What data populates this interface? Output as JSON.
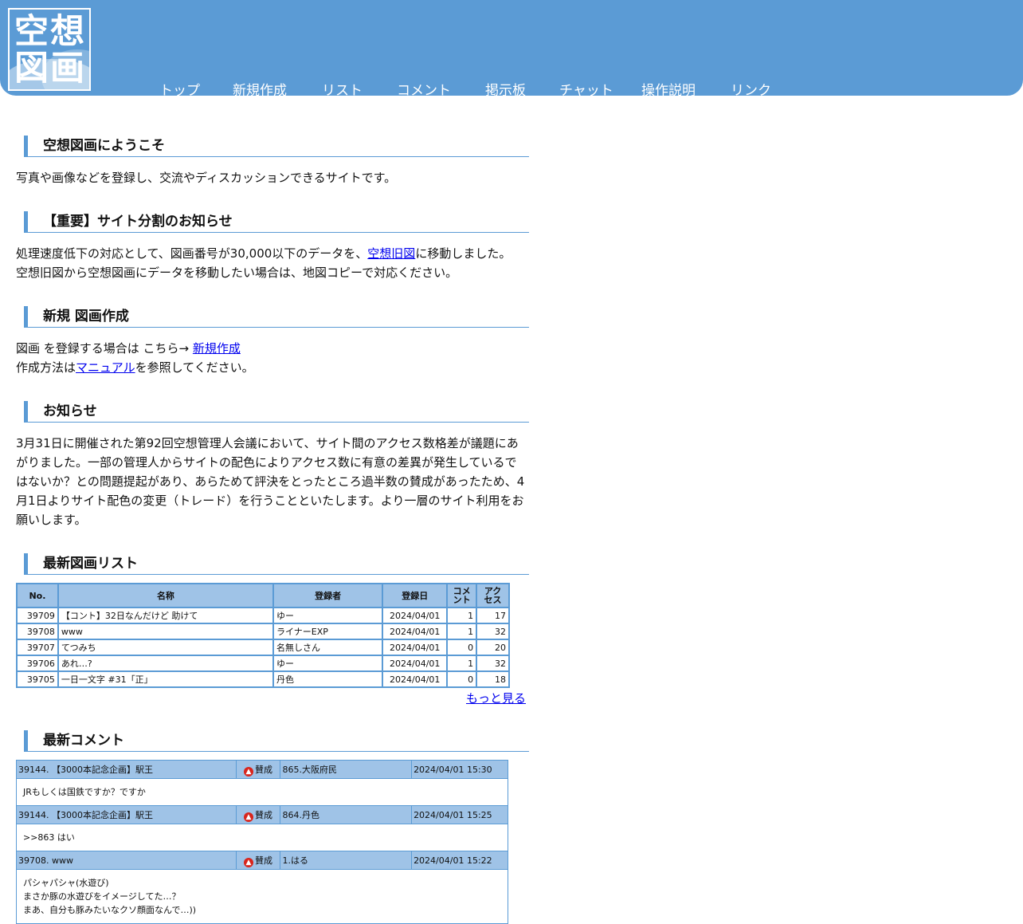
{
  "header": {
    "logo_line1": "空想",
    "logo_line2": "図画",
    "nav": [
      {
        "label": "トップ"
      },
      {
        "label": "新規作成"
      },
      {
        "label": "リスト"
      },
      {
        "label": "コメント"
      },
      {
        "label": "掲示板"
      },
      {
        "label": "チャット"
      },
      {
        "label": "操作説明"
      },
      {
        "label": "リンク"
      }
    ],
    "colors": {
      "bar": "#5b9bd5",
      "table_header": "#9fc3e7"
    }
  },
  "welcome": {
    "title": "空想図画にようこそ",
    "text": "写真や画像などを登録し、交流やディスカッションできるサイトです。"
  },
  "important": {
    "title": "【重要】サイト分割のお知らせ",
    "text_before": "処理速度低下の対応として、図画番号が30,000以下のデータを、",
    "link": "空想旧図",
    "text_after": "に移動しました。 空想旧図から空想図画にデータを移動したい場合は、地図コピーで対応ください。"
  },
  "create": {
    "title": "新規 図画作成",
    "line1_text": "図画 を登録する場合は こちら→ ",
    "line1_link": "新規作成",
    "line2_link": "マニュアル",
    "line2_text_before": "作成方法は",
    "line2_text_after": "を参照してください。"
  },
  "notice": {
    "title": "お知らせ",
    "text": "3月31日に開催された第92回空想管理人会議において、サイト間のアクセス数格差が議題にあがりました。一部の管理人からサイトの配色によりアクセス数に有意の差異が発生しているではないか？との問題提起があり、あらためて評決をとったところ過半数の賛成があったため、4月1日よりサイト配色の変更（トレード）を行うことといたします。より一層のサイト利用をお願いします。"
  },
  "latest": {
    "title": "最新図画リスト",
    "columns": {
      "no": "No.",
      "name": "名称",
      "user": "登録者",
      "date": "登録日",
      "comments": "コメント",
      "access": "アクセス"
    },
    "rows": [
      {
        "no": "39709",
        "name": "【コント】32日なんだけど 助けて",
        "user": "ゆー",
        "date": "2024/04/01",
        "comments": "1",
        "access": "17"
      },
      {
        "no": "39708",
        "name": "www",
        "user": "ライナーEXP",
        "date": "2024/04/01",
        "comments": "1",
        "access": "32"
      },
      {
        "no": "39707",
        "name": "てつみち",
        "user": "名無しさん",
        "date": "2024/04/01",
        "comments": "0",
        "access": "20"
      },
      {
        "no": "39706",
        "name": "あれ…?",
        "user": "ゆー",
        "date": "2024/04/01",
        "comments": "1",
        "access": "32"
      },
      {
        "no": "39705",
        "name": "一日一文字 #31「正」",
        "user": "丹色",
        "date": "2024/04/01",
        "comments": "0",
        "access": "18"
      }
    ],
    "more_link": "もっと見る"
  },
  "comments": {
    "title": "最新コメント",
    "vote_label": "賛成",
    "items": [
      {
        "map": "39144. 【3000本記念企画】駅王",
        "author": "865.大阪府民",
        "date": "2024/04/01 15:30",
        "lines": [
          "JRもしくは国鉄ですか？ですか"
        ]
      },
      {
        "map": "39144. 【3000本記念企画】駅王",
        "author": "864.丹色",
        "date": "2024/04/01 15:25",
        "lines": [
          ">>863 はい"
        ]
      },
      {
        "map": "39708. www",
        "author": "1.はる",
        "date": "2024/04/01 15:22",
        "lines": [
          "パシャパシャ(水遊び)",
          "まさか豚の水遊びをイメージしてた…？",
          "まあ、自分も豚みたいなクソ顔面なんで…))"
        ]
      }
    ]
  }
}
